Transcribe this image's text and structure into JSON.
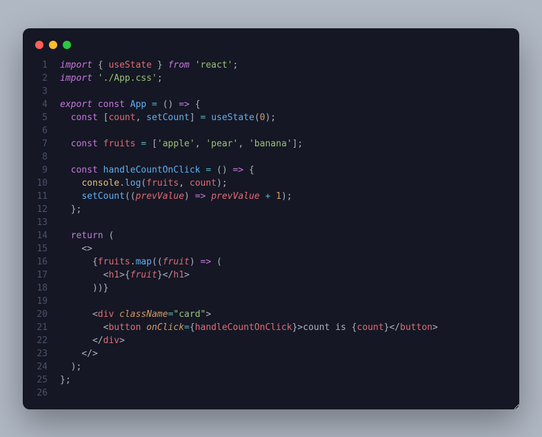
{
  "window": {
    "traffic_lights": [
      "close",
      "minimize",
      "zoom"
    ]
  },
  "editor": {
    "line_count": 26,
    "lines": {
      "1": [
        [
          "keyword2",
          "import"
        ],
        [
          "punct",
          " { "
        ],
        [
          "ident",
          "useState"
        ],
        [
          "punct",
          " } "
        ],
        [
          "keyword2",
          "from"
        ],
        [
          "punct",
          " "
        ],
        [
          "string",
          "'react'"
        ],
        [
          "punct",
          ";"
        ]
      ],
      "2": [
        [
          "keyword2",
          "import"
        ],
        [
          "punct",
          " "
        ],
        [
          "string",
          "'./App.css'"
        ],
        [
          "punct",
          ";"
        ]
      ],
      "3": [],
      "4": [
        [
          "keyword2",
          "export"
        ],
        [
          "punct",
          " "
        ],
        [
          "keyword",
          "const"
        ],
        [
          "punct",
          " "
        ],
        [
          "func",
          "App"
        ],
        [
          "punct",
          " "
        ],
        [
          "op",
          "="
        ],
        [
          "punct",
          " () "
        ],
        [
          "keyword",
          "=>"
        ],
        [
          "punct",
          " {"
        ]
      ],
      "5": [
        [
          "punct",
          "  "
        ],
        [
          "keyword",
          "const"
        ],
        [
          "punct",
          " ["
        ],
        [
          "ident",
          "count"
        ],
        [
          "punct",
          ", "
        ],
        [
          "func",
          "setCount"
        ],
        [
          "punct",
          "] "
        ],
        [
          "op",
          "="
        ],
        [
          "punct",
          " "
        ],
        [
          "func",
          "useState"
        ],
        [
          "punct",
          "("
        ],
        [
          "num",
          "0"
        ],
        [
          "punct",
          ");"
        ]
      ],
      "6": [],
      "7": [
        [
          "punct",
          "  "
        ],
        [
          "keyword",
          "const"
        ],
        [
          "punct",
          " "
        ],
        [
          "ident",
          "fruits"
        ],
        [
          "punct",
          " "
        ],
        [
          "op",
          "="
        ],
        [
          "punct",
          " ["
        ],
        [
          "string",
          "'apple'"
        ],
        [
          "punct",
          ", "
        ],
        [
          "string",
          "'pear'"
        ],
        [
          "punct",
          ", "
        ],
        [
          "string",
          "'banana'"
        ],
        [
          "punct",
          "];"
        ]
      ],
      "8": [],
      "9": [
        [
          "punct",
          "  "
        ],
        [
          "keyword",
          "const"
        ],
        [
          "punct",
          " "
        ],
        [
          "func",
          "handleCountOnClick"
        ],
        [
          "punct",
          " "
        ],
        [
          "op",
          "="
        ],
        [
          "punct",
          " () "
        ],
        [
          "keyword",
          "=>"
        ],
        [
          "punct",
          " {"
        ]
      ],
      "10": [
        [
          "punct",
          "    "
        ],
        [
          "builtin",
          "console"
        ],
        [
          "punct",
          "."
        ],
        [
          "func",
          "log"
        ],
        [
          "punct",
          "("
        ],
        [
          "ident",
          "fruits"
        ],
        [
          "punct",
          ", "
        ],
        [
          "ident",
          "count"
        ],
        [
          "punct",
          ");"
        ]
      ],
      "11": [
        [
          "punct",
          "    "
        ],
        [
          "func",
          "setCount"
        ],
        [
          "punct",
          "(("
        ],
        [
          "param",
          "prevValue"
        ],
        [
          "punct",
          ") "
        ],
        [
          "keyword",
          "=>"
        ],
        [
          "punct",
          " "
        ],
        [
          "param",
          "prevValue"
        ],
        [
          "punct",
          " "
        ],
        [
          "op",
          "+"
        ],
        [
          "punct",
          " "
        ],
        [
          "num",
          "1"
        ],
        [
          "punct",
          ");"
        ]
      ],
      "12": [
        [
          "punct",
          "  };"
        ]
      ],
      "13": [],
      "14": [
        [
          "punct",
          "  "
        ],
        [
          "keyword",
          "return"
        ],
        [
          "punct",
          " ("
        ]
      ],
      "15": [
        [
          "punct",
          "    <>"
        ]
      ],
      "16": [
        [
          "punct",
          "      {"
        ],
        [
          "ident",
          "fruits"
        ],
        [
          "punct",
          "."
        ],
        [
          "func",
          "map"
        ],
        [
          "punct",
          "(("
        ],
        [
          "param",
          "fruit"
        ],
        [
          "punct",
          ") "
        ],
        [
          "keyword",
          "=>"
        ],
        [
          "punct",
          " ("
        ]
      ],
      "17": [
        [
          "punct",
          "        <"
        ],
        [
          "tag",
          "h1"
        ],
        [
          "punct",
          ">{"
        ],
        [
          "param",
          "fruit"
        ],
        [
          "punct",
          "}</"
        ],
        [
          "tag",
          "h1"
        ],
        [
          "punct",
          ">"
        ]
      ],
      "18": [
        [
          "punct",
          "      ))}"
        ]
      ],
      "19": [],
      "20": [
        [
          "punct",
          "      <"
        ],
        [
          "tag",
          "div"
        ],
        [
          "punct",
          " "
        ],
        [
          "attr",
          "className"
        ],
        [
          "op",
          "="
        ],
        [
          "string",
          "\"card\""
        ],
        [
          "punct",
          ">"
        ]
      ],
      "21": [
        [
          "punct",
          "        <"
        ],
        [
          "tag",
          "button"
        ],
        [
          "punct",
          " "
        ],
        [
          "attr",
          "onClick"
        ],
        [
          "op",
          "="
        ],
        [
          "punct",
          "{"
        ],
        [
          "ident",
          "handleCountOnClick"
        ],
        [
          "punct",
          "}>count is {"
        ],
        [
          "ident",
          "count"
        ],
        [
          "punct",
          "}</"
        ],
        [
          "tag",
          "button"
        ],
        [
          "punct",
          ">"
        ]
      ],
      "22": [
        [
          "punct",
          "      </"
        ],
        [
          "tag",
          "div"
        ],
        [
          "punct",
          ">"
        ]
      ],
      "23": [
        [
          "punct",
          "    </>"
        ]
      ],
      "24": [
        [
          "punct",
          "  );"
        ]
      ],
      "25": [
        [
          "punct",
          "};"
        ]
      ],
      "26": []
    }
  }
}
